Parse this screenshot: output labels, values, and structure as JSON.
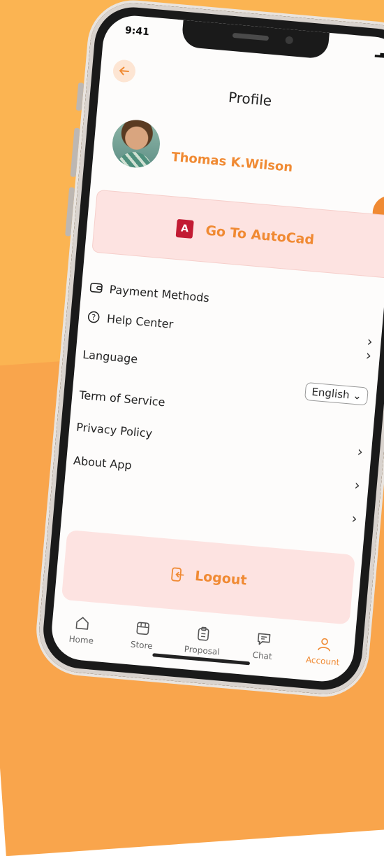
{
  "status_bar": {
    "time": "9:41",
    "signal": "▕▖▗ "
  },
  "header": {
    "title": "Profile"
  },
  "profile": {
    "name": "Thomas K.Wilson"
  },
  "autocad": {
    "label": "Go To AutoCad",
    "logo_letter": "A"
  },
  "menu": {
    "payment": "Payment Methods",
    "help": "Help Center",
    "language": "Language",
    "language_value": "English",
    "terms": "Term of Service",
    "privacy": "Privacy Policy",
    "about": "About App"
  },
  "logout": {
    "label": "Logout"
  },
  "tabs": [
    {
      "label": "Home"
    },
    {
      "label": "Store"
    },
    {
      "label": "Proposal"
    },
    {
      "label": "Chat"
    },
    {
      "label": "Account"
    }
  ],
  "colors": {
    "accent": "#F08A33",
    "background": "#FBB452",
    "card": "#FDE3E1"
  }
}
